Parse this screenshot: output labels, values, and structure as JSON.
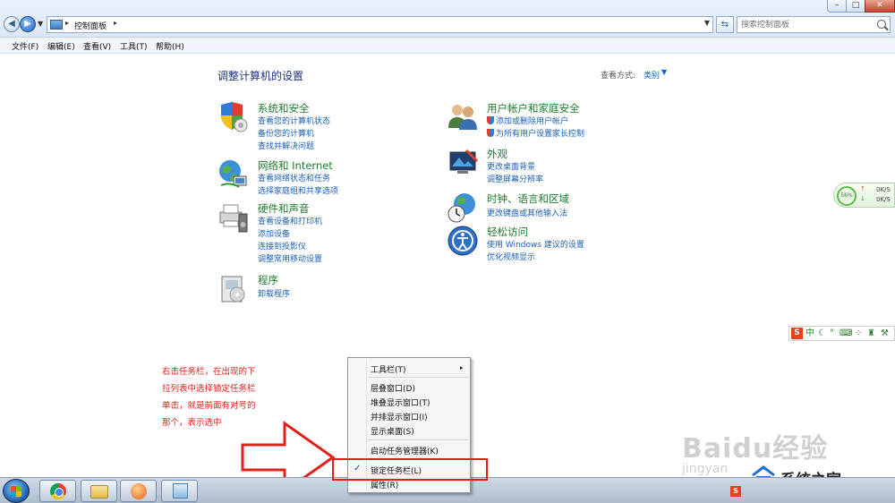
{
  "window": {
    "address": "控制面板",
    "search_placeholder": "搜索控制面板",
    "minimize": "–",
    "maximize": "□",
    "close": "✕"
  },
  "menubar": [
    "文件(F)",
    "编辑(E)",
    "查看(V)",
    "工具(T)",
    "帮助(H)"
  ],
  "content": {
    "title": "调整计算机的设置",
    "view_by_label": "查看方式:",
    "view_by_value": "类别"
  },
  "categories": {
    "system": {
      "title": "系统和安全",
      "links": [
        "查看您的计算机状态",
        "备份您的计算机",
        "查找并解决问题"
      ]
    },
    "network": {
      "title": "网络和 Internet",
      "links": [
        "查看网络状态和任务",
        "选择家庭组和共享选项"
      ]
    },
    "hardware": {
      "title": "硬件和声音",
      "links": [
        "查看设备和打印机",
        "添加设备",
        "连接到投影仪",
        "调整常用移动设置"
      ]
    },
    "programs": {
      "title": "程序",
      "links": [
        "卸载程序"
      ]
    },
    "users": {
      "title": "用户帐户和家庭安全",
      "links": [
        "添加或删除用户帐户",
        "为所有用户设置家长控制"
      ]
    },
    "appearance": {
      "title": "外观",
      "links": [
        "更改桌面背景",
        "调整屏幕分辨率"
      ]
    },
    "clock": {
      "title": "时钟、语言和区域",
      "links": [
        "更改键盘或其他输入法"
      ]
    },
    "ease": {
      "title": "轻松访问",
      "links": [
        "使用 Windows 建议的设置",
        "优化视频显示"
      ]
    }
  },
  "net_meter": {
    "percent": "56%",
    "up": "0K/S",
    "down": "0K/S"
  },
  "annotation": "右击任务栏，在出现的下拉列表中选择锁定任务栏单击，就是前面有对号的那个，表示选中",
  "context_menu": {
    "items": [
      "工具栏(T)",
      "层叠窗口(D)",
      "堆叠显示窗口(T)",
      "并排显示窗口(I)",
      "显示桌面(S)",
      "启动任务管理器(K)",
      "锁定任务栏(L)",
      "属性(R)"
    ],
    "checked_item": "锁定任务栏(L)",
    "check_mark": "✓",
    "submenu_arrow": "▸"
  },
  "watermarks": {
    "baidu": "Baidu经验",
    "jingyan": "jingyan",
    "site": "系统之家"
  },
  "ime_bar": {
    "logo": "S",
    "mode": "中"
  },
  "colors": {
    "link": "#1a5fb4",
    "category_title": "#1d7a2b",
    "annotation": "#e0201a",
    "page_title": "#1e3287"
  }
}
